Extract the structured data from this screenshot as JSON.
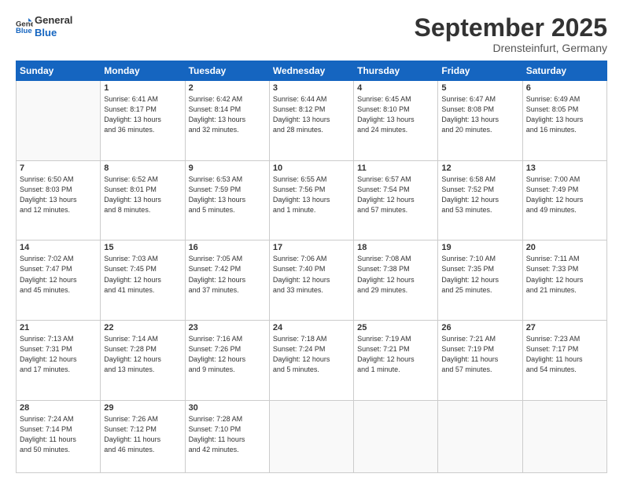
{
  "header": {
    "logo_line1": "General",
    "logo_line2": "Blue",
    "month": "September 2025",
    "location": "Drensteinfurt, Germany"
  },
  "weekdays": [
    "Sunday",
    "Monday",
    "Tuesday",
    "Wednesday",
    "Thursday",
    "Friday",
    "Saturday"
  ],
  "weeks": [
    [
      {
        "day": "",
        "detail": ""
      },
      {
        "day": "1",
        "detail": "Sunrise: 6:41 AM\nSunset: 8:17 PM\nDaylight: 13 hours\nand 36 minutes."
      },
      {
        "day": "2",
        "detail": "Sunrise: 6:42 AM\nSunset: 8:14 PM\nDaylight: 13 hours\nand 32 minutes."
      },
      {
        "day": "3",
        "detail": "Sunrise: 6:44 AM\nSunset: 8:12 PM\nDaylight: 13 hours\nand 28 minutes."
      },
      {
        "day": "4",
        "detail": "Sunrise: 6:45 AM\nSunset: 8:10 PM\nDaylight: 13 hours\nand 24 minutes."
      },
      {
        "day": "5",
        "detail": "Sunrise: 6:47 AM\nSunset: 8:08 PM\nDaylight: 13 hours\nand 20 minutes."
      },
      {
        "day": "6",
        "detail": "Sunrise: 6:49 AM\nSunset: 8:05 PM\nDaylight: 13 hours\nand 16 minutes."
      }
    ],
    [
      {
        "day": "7",
        "detail": "Sunrise: 6:50 AM\nSunset: 8:03 PM\nDaylight: 13 hours\nand 12 minutes."
      },
      {
        "day": "8",
        "detail": "Sunrise: 6:52 AM\nSunset: 8:01 PM\nDaylight: 13 hours\nand 8 minutes."
      },
      {
        "day": "9",
        "detail": "Sunrise: 6:53 AM\nSunset: 7:59 PM\nDaylight: 13 hours\nand 5 minutes."
      },
      {
        "day": "10",
        "detail": "Sunrise: 6:55 AM\nSunset: 7:56 PM\nDaylight: 13 hours\nand 1 minute."
      },
      {
        "day": "11",
        "detail": "Sunrise: 6:57 AM\nSunset: 7:54 PM\nDaylight: 12 hours\nand 57 minutes."
      },
      {
        "day": "12",
        "detail": "Sunrise: 6:58 AM\nSunset: 7:52 PM\nDaylight: 12 hours\nand 53 minutes."
      },
      {
        "day": "13",
        "detail": "Sunrise: 7:00 AM\nSunset: 7:49 PM\nDaylight: 12 hours\nand 49 minutes."
      }
    ],
    [
      {
        "day": "14",
        "detail": "Sunrise: 7:02 AM\nSunset: 7:47 PM\nDaylight: 12 hours\nand 45 minutes."
      },
      {
        "day": "15",
        "detail": "Sunrise: 7:03 AM\nSunset: 7:45 PM\nDaylight: 12 hours\nand 41 minutes."
      },
      {
        "day": "16",
        "detail": "Sunrise: 7:05 AM\nSunset: 7:42 PM\nDaylight: 12 hours\nand 37 minutes."
      },
      {
        "day": "17",
        "detail": "Sunrise: 7:06 AM\nSunset: 7:40 PM\nDaylight: 12 hours\nand 33 minutes."
      },
      {
        "day": "18",
        "detail": "Sunrise: 7:08 AM\nSunset: 7:38 PM\nDaylight: 12 hours\nand 29 minutes."
      },
      {
        "day": "19",
        "detail": "Sunrise: 7:10 AM\nSunset: 7:35 PM\nDaylight: 12 hours\nand 25 minutes."
      },
      {
        "day": "20",
        "detail": "Sunrise: 7:11 AM\nSunset: 7:33 PM\nDaylight: 12 hours\nand 21 minutes."
      }
    ],
    [
      {
        "day": "21",
        "detail": "Sunrise: 7:13 AM\nSunset: 7:31 PM\nDaylight: 12 hours\nand 17 minutes."
      },
      {
        "day": "22",
        "detail": "Sunrise: 7:14 AM\nSunset: 7:28 PM\nDaylight: 12 hours\nand 13 minutes."
      },
      {
        "day": "23",
        "detail": "Sunrise: 7:16 AM\nSunset: 7:26 PM\nDaylight: 12 hours\nand 9 minutes."
      },
      {
        "day": "24",
        "detail": "Sunrise: 7:18 AM\nSunset: 7:24 PM\nDaylight: 12 hours\nand 5 minutes."
      },
      {
        "day": "25",
        "detail": "Sunrise: 7:19 AM\nSunset: 7:21 PM\nDaylight: 12 hours\nand 1 minute."
      },
      {
        "day": "26",
        "detail": "Sunrise: 7:21 AM\nSunset: 7:19 PM\nDaylight: 11 hours\nand 57 minutes."
      },
      {
        "day": "27",
        "detail": "Sunrise: 7:23 AM\nSunset: 7:17 PM\nDaylight: 11 hours\nand 54 minutes."
      }
    ],
    [
      {
        "day": "28",
        "detail": "Sunrise: 7:24 AM\nSunset: 7:14 PM\nDaylight: 11 hours\nand 50 minutes."
      },
      {
        "day": "29",
        "detail": "Sunrise: 7:26 AM\nSunset: 7:12 PM\nDaylight: 11 hours\nand 46 minutes."
      },
      {
        "day": "30",
        "detail": "Sunrise: 7:28 AM\nSunset: 7:10 PM\nDaylight: 11 hours\nand 42 minutes."
      },
      {
        "day": "",
        "detail": ""
      },
      {
        "day": "",
        "detail": ""
      },
      {
        "day": "",
        "detail": ""
      },
      {
        "day": "",
        "detail": ""
      }
    ]
  ]
}
